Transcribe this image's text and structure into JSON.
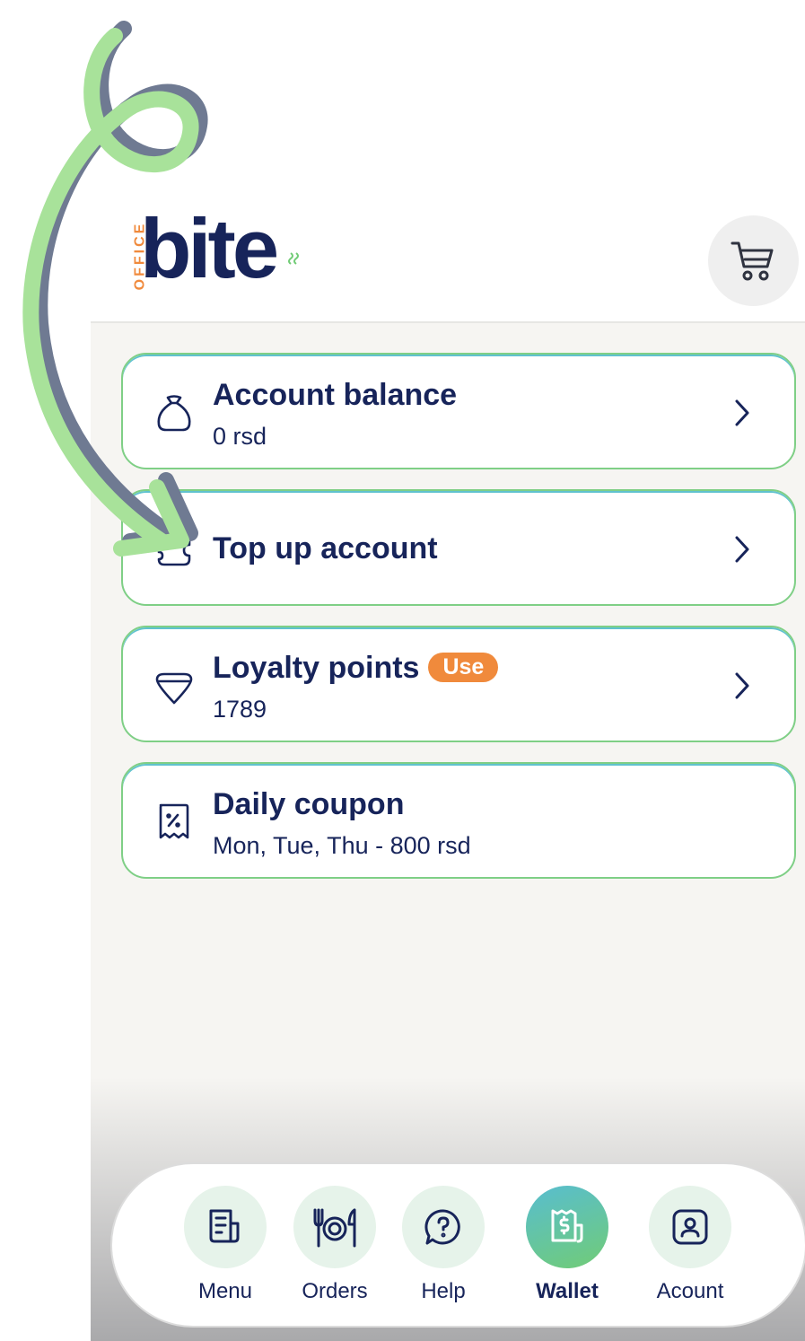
{
  "header": {
    "logo_small": "OFFICE",
    "logo_main": "bite",
    "cart_icon": "cart-icon"
  },
  "wallet": {
    "items": [
      {
        "title": "Account balance",
        "subtitle": "0 rsd",
        "icon": "money-bag-icon"
      },
      {
        "title": "Top up account",
        "icon": "wallet-top-up-icon"
      },
      {
        "title": "Loyalty points",
        "badge": "Use",
        "subtitle": "1789",
        "icon": "diamond-icon"
      },
      {
        "title": "Daily coupon",
        "subtitle": "Mon, Tue, Thu - 800 rsd",
        "icon": "coupon-icon"
      }
    ]
  },
  "nav": {
    "items": [
      {
        "label": "Menu",
        "icon": "menu-icon"
      },
      {
        "label": "Orders",
        "icon": "orders-icon"
      },
      {
        "label": "Help",
        "icon": "help-icon"
      },
      {
        "label": "Wallet",
        "icon": "wallet-icon",
        "active": true
      },
      {
        "label": "Acount",
        "icon": "account-icon"
      }
    ]
  },
  "colors": {
    "navy": "#17245a",
    "accent_orange": "#f08a3c",
    "accent_green": "#71cc76",
    "accent_teal": "#58bdd0",
    "annotation_arrow": "#a8e29a"
  }
}
